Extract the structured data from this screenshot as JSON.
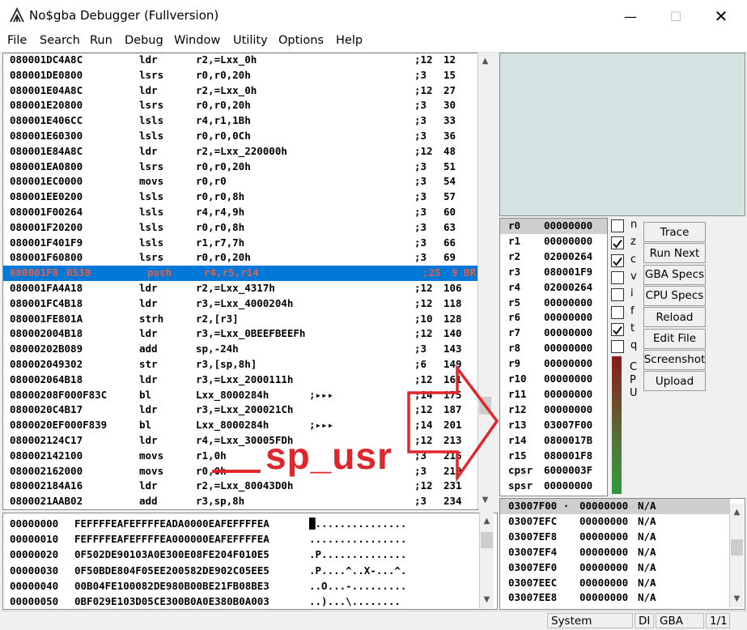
{
  "window": {
    "title": "No$gba Debugger (Fullversion)",
    "minimize_icon": "minimize-icon",
    "maximize_icon": "maximize-icon",
    "close_icon": "close-icon"
  },
  "menu": [
    "File",
    "Search",
    "Run",
    "Debug",
    "Window",
    "Utility",
    "Options",
    "Help"
  ],
  "disasm": [
    {
      "addr": "080001DC",
      "op": "4A8C",
      "mn": "ldr",
      "args": "r2,=Lxx_0h",
      "cyc": ";12",
      "tot": "12"
    },
    {
      "addr": "080001DE",
      "op": "0800",
      "mn": "lsrs",
      "args": "r0,r0,20h",
      "cyc": ";3",
      "tot": "15"
    },
    {
      "addr": "080001E0",
      "op": "4A8C",
      "mn": "ldr",
      "args": "r2,=Lxx_0h",
      "cyc": ";12",
      "tot": "27"
    },
    {
      "addr": "080001E2",
      "op": "0800",
      "mn": "lsrs",
      "args": "r0,r0,20h",
      "cyc": ";3",
      "tot": "30"
    },
    {
      "addr": "080001E4",
      "op": "06CC",
      "mn": "lsls",
      "args": "r4,r1,1Bh",
      "cyc": ";3",
      "tot": "33"
    },
    {
      "addr": "080001E6",
      "op": "0300",
      "mn": "lsls",
      "args": "r0,r0,0Ch",
      "cyc": ";3",
      "tot": "36"
    },
    {
      "addr": "080001E8",
      "op": "4A8C",
      "mn": "ldr",
      "args": "r2,=Lxx_220000h",
      "cyc": ";12",
      "tot": "48"
    },
    {
      "addr": "080001EA",
      "op": "0800",
      "mn": "lsrs",
      "args": "r0,r0,20h",
      "cyc": ";3",
      "tot": "51"
    },
    {
      "addr": "080001EC",
      "op": "0000",
      "mn": "movs",
      "args": "r0,r0",
      "cyc": ";3",
      "tot": "54"
    },
    {
      "addr": "080001EE",
      "op": "0200",
      "mn": "lsls",
      "args": "r0,r0,8h",
      "cyc": ";3",
      "tot": "57"
    },
    {
      "addr": "080001F0",
      "op": "0264",
      "mn": "lsls",
      "args": "r4,r4,9h",
      "cyc": ";3",
      "tot": "60"
    },
    {
      "addr": "080001F2",
      "op": "0200",
      "mn": "lsls",
      "args": "r0,r0,8h",
      "cyc": ";3",
      "tot": "63"
    },
    {
      "addr": "080001F4",
      "op": "01F9",
      "mn": "lsls",
      "args": "r1,r7,7h",
      "cyc": ";3",
      "tot": "66"
    },
    {
      "addr": "080001F6",
      "op": "0800",
      "mn": "lsrs",
      "args": "r0,r0,20h",
      "cyc": ";3",
      "tot": "69"
    },
    {
      "addr": "080001F8 ·",
      "op": "B530",
      "mn": "push",
      "args": "r4,r5,r14",
      "cyc": ";25",
      "tot": "9 BR",
      "sel": true
    },
    {
      "addr": "080001FA",
      "op": "4A18",
      "mn": "ldr",
      "args": "r2,=Lxx_4317h",
      "cyc": ";12",
      "tot": "106"
    },
    {
      "addr": "080001FC",
      "op": "4B18",
      "mn": "ldr",
      "args": "r3,=Lxx_4000204h",
      "cyc": ";12",
      "tot": "118"
    },
    {
      "addr": "080001FE",
      "op": "801A",
      "mn": "strh",
      "args": "r2,[r3]",
      "cyc": ";10",
      "tot": "128"
    },
    {
      "addr": "08000200",
      "op": "4B18",
      "mn": "ldr",
      "args": "r3,=Lxx_0BEEFBEEFh",
      "cyc": ";12",
      "tot": "140"
    },
    {
      "addr": "08000202",
      "op": "B089",
      "mn": "add",
      "args": "sp,-24h",
      "cyc": ";3",
      "tot": "143"
    },
    {
      "addr": "08000204",
      "op": "9302",
      "mn": "str",
      "args": "r3,[sp,8h]",
      "cyc": ";6",
      "tot": "149"
    },
    {
      "addr": "08000206",
      "op": "4B18",
      "mn": "ldr",
      "args": "r3,=Lxx_2000111h",
      "cyc": ";12",
      "tot": "161"
    },
    {
      "addr": "08000208",
      "op": "F000F83C",
      "mn": "bl",
      "args": "Lxx_8000284h",
      "extra": ";▸▸▸",
      "cyc": ";14",
      "tot": "175"
    },
    {
      "addr": "0800020C",
      "op": "4B17",
      "mn": "ldr",
      "args": "r3,=Lxx_200021Ch",
      "cyc": ";12",
      "tot": "187"
    },
    {
      "addr": "0800020E",
      "op": "F000F839",
      "mn": "bl",
      "args": "Lxx_8000284h",
      "extra": ";▸▸▸",
      "cyc": ";14",
      "tot": "201"
    },
    {
      "addr": "08000212",
      "op": "4C17",
      "mn": "ldr",
      "args": "r4,=Lxx_30005FDh",
      "cyc": ";12",
      "tot": "213"
    },
    {
      "addr": "08000214",
      "op": "2100",
      "mn": "movs",
      "args": "r1,0h",
      "cyc": ";3",
      "tot": "216"
    },
    {
      "addr": "08000216",
      "op": "2000",
      "mn": "movs",
      "args": "r0,0h",
      "cyc": ";3",
      "tot": "219"
    },
    {
      "addr": "08000218",
      "op": "4A16",
      "mn": "ldr",
      "args": "r2,=Lxx_80043D0h",
      "cyc": ";12",
      "tot": "231"
    },
    {
      "addr": "0800021A",
      "op": "AB02",
      "mn": "add",
      "args": "r3,sp,8h",
      "cyc": ";3",
      "tot": "234"
    }
  ],
  "hex": [
    {
      "addr": "00000000",
      "bytes": "FEFFFFEAFEFFFFEADA0000EAFEFFFFEA",
      "ascii": "█..............."
    },
    {
      "addr": "00000010",
      "bytes": "FEFFFFEAFEFFFFEA000000EAFEFFFFEA",
      "ascii": "................"
    },
    {
      "addr": "00000020",
      "bytes": "0F502DE90103A0E300E08FE204F010E5",
      "ascii": ".P.............."
    },
    {
      "addr": "00000030",
      "bytes": "0F50BDE804F05EE200582DE902C05EE5",
      "ascii": ".P....^..X-...^."
    },
    {
      "addr": "00000040",
      "bytes": "00B04FE100082DE980B00BE21FB08BE3",
      "ascii": "..O...-........."
    },
    {
      "addr": "00000050",
      "bytes": "0BF029E103D05CE300B0A0E380B0A003",
      "ascii": "..)...\\........"
    }
  ],
  "registers": [
    {
      "name": "r0",
      "val": "00000000"
    },
    {
      "name": "r1",
      "val": "00000000"
    },
    {
      "name": "r2",
      "val": "02000264"
    },
    {
      "name": "r3",
      "val": "080001F9"
    },
    {
      "name": "r4",
      "val": "02000264"
    },
    {
      "name": "r5",
      "val": "00000000"
    },
    {
      "name": "r6",
      "val": "00000000"
    },
    {
      "name": "r7",
      "val": "00000000"
    },
    {
      "name": "r8",
      "val": "00000000"
    },
    {
      "name": "r9",
      "val": "00000000"
    },
    {
      "name": "r10",
      "val": "00000000"
    },
    {
      "name": "r11",
      "val": "00000000"
    },
    {
      "name": "r12",
      "val": "00000000"
    },
    {
      "name": "r13",
      "val": "03007F00"
    },
    {
      "name": "r14",
      "val": "0800017B"
    },
    {
      "name": "r15",
      "val": "080001F8"
    },
    {
      "name": "cpsr",
      "val": "6000003F"
    },
    {
      "name": "spsr",
      "val": "00000000"
    }
  ],
  "flags": [
    {
      "label": "n",
      "checked": false
    },
    {
      "label": "z",
      "checked": true
    },
    {
      "label": "c",
      "checked": true
    },
    {
      "label": "v",
      "checked": false
    },
    {
      "label": "i",
      "checked": false
    },
    {
      "label": "f",
      "checked": false
    },
    {
      "label": "t",
      "checked": true
    },
    {
      "label": "q",
      "checked": false
    }
  ],
  "cpu_label": [
    "C",
    "P",
    "U"
  ],
  "buttons": [
    "Trace",
    "Run Next",
    "GBA Specs",
    "CPU Specs",
    "Reload",
    "Edit File",
    "Screenshot",
    "Upload"
  ],
  "stack": [
    {
      "addr": "03007F00 ·",
      "val": "00000000",
      "note": "N/A"
    },
    {
      "addr": "03007EFC",
      "val": "00000000",
      "note": "N/A"
    },
    {
      "addr": "03007EF8",
      "val": "00000000",
      "note": "N/A"
    },
    {
      "addr": "03007EF4",
      "val": "00000000",
      "note": "N/A"
    },
    {
      "addr": "03007EF0",
      "val": "00000000",
      "note": "N/A"
    },
    {
      "addr": "03007EEC",
      "val": "00000000",
      "note": "N/A"
    },
    {
      "addr": "03007EE8",
      "val": "00000000",
      "note": "N/A"
    }
  ],
  "status": {
    "mode": "System",
    "di": "DI",
    "sys": "GBA",
    "page": "1/1"
  },
  "annotation": {
    "text": "sp_usr",
    "color": "#e0262a"
  }
}
